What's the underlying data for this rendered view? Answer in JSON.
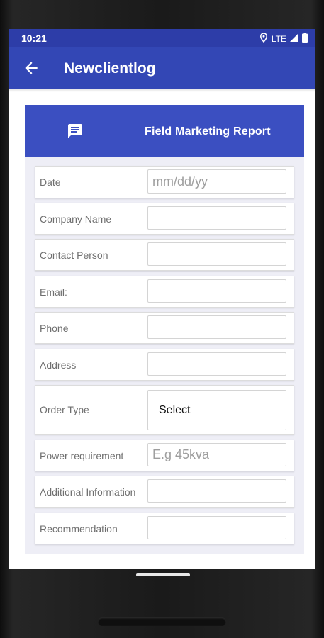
{
  "status_bar": {
    "time": "10:21",
    "network": "LTE"
  },
  "app_bar": {
    "title": "Newclientlog"
  },
  "card": {
    "title": "Field Marketing Report"
  },
  "form": {
    "date": {
      "label": "Date",
      "placeholder": "mm/dd/yy"
    },
    "company": {
      "label": "Company Name",
      "placeholder": ""
    },
    "contact": {
      "label": "Contact Person",
      "placeholder": ""
    },
    "email": {
      "label": "Email:",
      "placeholder": ""
    },
    "phone": {
      "label": "Phone",
      "placeholder": ""
    },
    "address": {
      "label": "Address",
      "placeholder": ""
    },
    "order_type": {
      "label": "Order Type",
      "selected": "Select"
    },
    "power": {
      "label": "Power requirement",
      "placeholder": "E.g 45kva"
    },
    "additional": {
      "label": "Additional Information",
      "placeholder": ""
    },
    "recommendation": {
      "label": "Recommendation",
      "placeholder": ""
    }
  },
  "icons": {
    "back": "arrow-left-icon",
    "header": "chat-bubble-icon",
    "status": [
      "location-icon",
      "signal-icon",
      "battery-icon"
    ]
  },
  "colors": {
    "status_bar": "#2d3da8",
    "app_bar": "#3347b5",
    "card_header": "#3b4fc1",
    "card_background": "#eeeef6"
  }
}
